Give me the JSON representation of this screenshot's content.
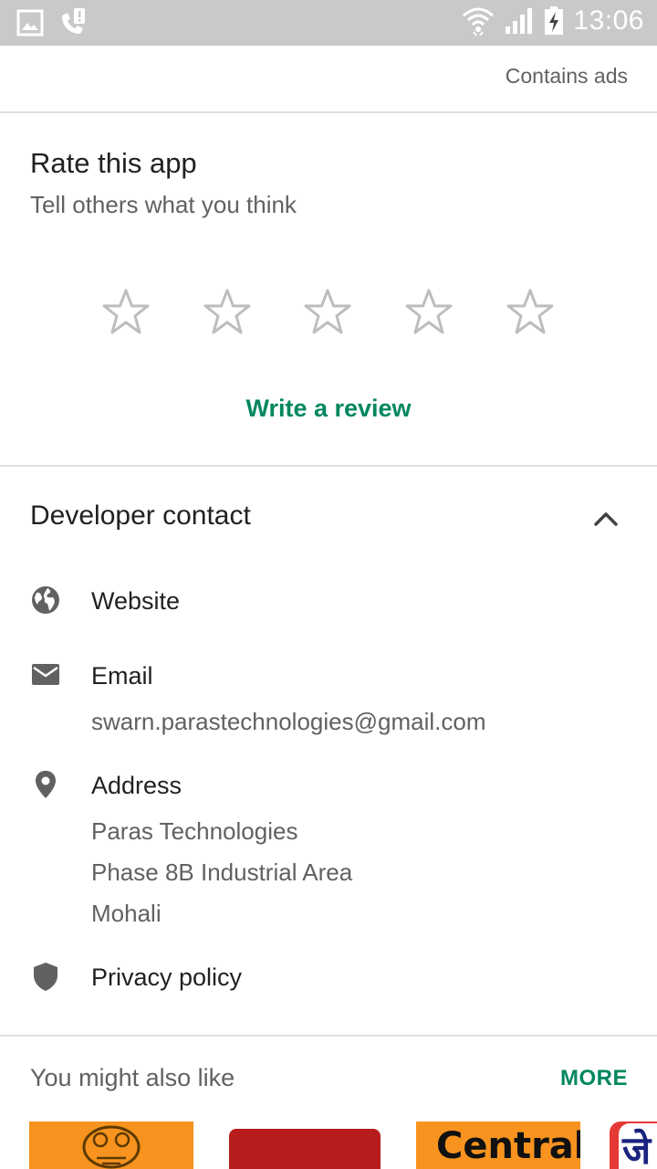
{
  "status_bar": {
    "time": "13:06",
    "icons": [
      "gallery-icon",
      "missed-call-icon",
      "wifi-icon",
      "signal-icon",
      "battery-charging-icon"
    ]
  },
  "header": {
    "contains_ads": "Contains ads"
  },
  "rate": {
    "title": "Rate this app",
    "subtitle": "Tell others what you think",
    "stars_total": 5,
    "rating": 0,
    "write_review": "Write a review"
  },
  "developer_contact": {
    "title": "Developer contact",
    "website": {
      "label": "Website"
    },
    "email": {
      "label": "Email",
      "value": "swarn.parastechnologies@gmail.com"
    },
    "address": {
      "label": "Address",
      "lines": [
        "Paras Technologies",
        "Phase 8B Industrial Area",
        "Mohali"
      ]
    },
    "privacy": {
      "label": "Privacy policy"
    }
  },
  "also_like": {
    "title": "You might also like",
    "more": "MORE",
    "apps": [
      {
        "thumb_text": ""
      },
      {
        "thumb_text": ""
      },
      {
        "thumb_text": "Central"
      },
      {
        "thumb_text": "जे"
      }
    ]
  },
  "colors": {
    "accent": "#01875f",
    "status_bar": "#c9c9c9",
    "divider": "#e0e0e0",
    "secondary_text": "#616161",
    "icon_grey": "#616161",
    "star_outline": "#bdbdbd"
  }
}
